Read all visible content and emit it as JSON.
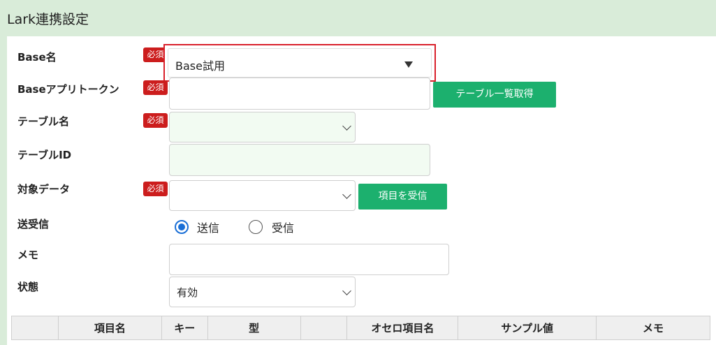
{
  "page": {
    "title": "Lark連携設定"
  },
  "required_badge": "必須",
  "form": {
    "base_name": {
      "label": "Base名",
      "value": "Base試用"
    },
    "base_app_token": {
      "label": "Baseアプリトークン",
      "value": "",
      "button": "テーブル一覧取得"
    },
    "table_name": {
      "label": "テーブル名",
      "value": ""
    },
    "table_id": {
      "label": "テーブルID",
      "value": ""
    },
    "target_data": {
      "label": "対象データ",
      "value": "",
      "button": "項目を受信"
    },
    "direction": {
      "label": "送受信",
      "options": [
        "送信",
        "受信"
      ],
      "selected": "送信"
    },
    "memo": {
      "label": "メモ",
      "value": ""
    },
    "status": {
      "label": "状態",
      "value": "有効"
    }
  },
  "table": {
    "columns": [
      "",
      "項目名",
      "キー",
      "型",
      "",
      "オセロ項目名",
      "サンプル値",
      "メモ"
    ]
  },
  "colors": {
    "header_bg": "#d9ecd9",
    "accent_button": "#1cb06e",
    "required": "#cc1d1d",
    "highlight": "#d9202b"
  },
  "icons": {
    "select_arrow": "triangle-down-icon",
    "dropdown": "chevron-down-icon"
  }
}
